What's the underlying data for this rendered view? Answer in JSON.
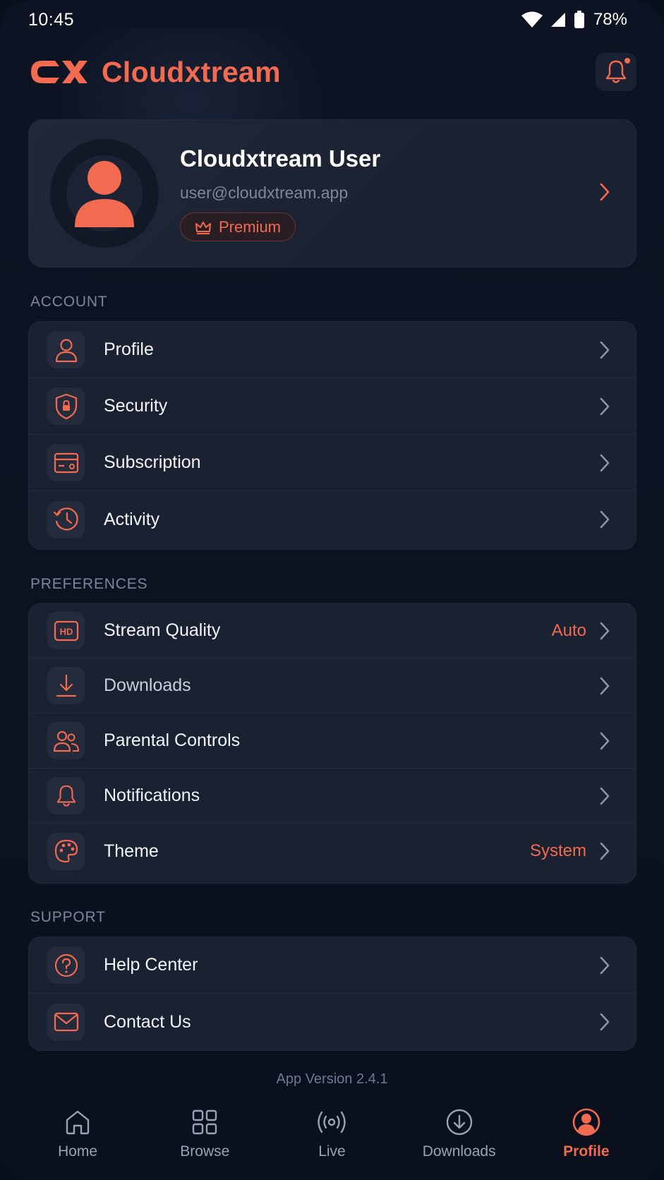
{
  "status_bar": {
    "time": "10:45",
    "battery_percent": "78%"
  },
  "header": {
    "app_title": "Cloudxtream",
    "logo_icon": "cloudxtream-logo",
    "notification_icon": "bell-icon",
    "has_notification_dot": true
  },
  "profile": {
    "name": "Cloudxtream User",
    "email": "user@cloudxtream.app",
    "badge": "Premium"
  },
  "sections": {
    "account": {
      "label": "ACCOUNT",
      "items": [
        {
          "label": "Profile",
          "icon": "user-icon"
        },
        {
          "label": "Security",
          "icon": "shield-lock-icon"
        },
        {
          "label": "Subscription",
          "icon": "card-icon"
        },
        {
          "label": "Activity",
          "icon": "history-icon"
        }
      ]
    },
    "preferences": {
      "label": "PREFERENCES",
      "items": [
        {
          "label": "Stream Quality",
          "icon": "hd-icon",
          "value": "Auto"
        },
        {
          "label": "Downloads",
          "icon": "download-icon"
        },
        {
          "label": "Parental Controls",
          "icon": "users-icon"
        },
        {
          "label": "Notifications",
          "icon": "bell-icon"
        },
        {
          "label": "Theme",
          "icon": "palette-icon",
          "value": "System"
        }
      ]
    },
    "support": {
      "label": "SUPPORT",
      "items": [
        {
          "label": "Help Center",
          "icon": "help-icon"
        },
        {
          "label": "Contact Us",
          "icon": "mail-icon"
        }
      ]
    }
  },
  "app_version": "App Version 2.4.1",
  "bottom_nav": [
    {
      "label": "Home",
      "icon": "home-icon",
      "active": false
    },
    {
      "label": "Browse",
      "icon": "grid-icon",
      "active": false
    },
    {
      "label": "Live",
      "icon": "broadcast-icon",
      "active": false
    },
    {
      "label": "Downloads",
      "icon": "download-circle-icon",
      "active": false
    },
    {
      "label": "Profile",
      "icon": "profile-circle-icon",
      "active": true
    }
  ],
  "colors": {
    "accent": "#f26a4f",
    "background": "#0c1220",
    "card": "#1a2131",
    "muted_text": "#7c869a"
  }
}
